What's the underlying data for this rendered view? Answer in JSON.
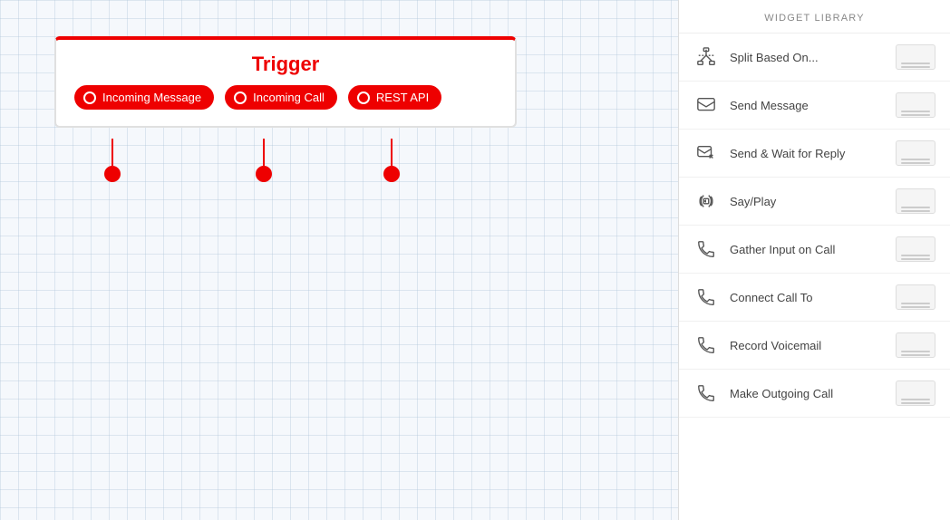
{
  "trigger": {
    "title": "Trigger",
    "buttons": [
      {
        "label": "Incoming Message"
      },
      {
        "label": "Incoming Call"
      },
      {
        "label": "REST API"
      }
    ]
  },
  "sidebar": {
    "header": "WIDGET LIBRARY",
    "widgets": [
      {
        "name": "split-based-on",
        "label": "Split Based On...",
        "icon": "split"
      },
      {
        "name": "send-message",
        "label": "Send Message",
        "icon": "message"
      },
      {
        "name": "send-wait-reply",
        "label": "Send & Wait for Reply",
        "icon": "message-reply"
      },
      {
        "name": "say-play",
        "label": "Say/Play",
        "icon": "phone"
      },
      {
        "name": "gather-input",
        "label": "Gather Input on Call",
        "icon": "phone"
      },
      {
        "name": "connect-call",
        "label": "Connect Call To",
        "icon": "phone"
      },
      {
        "name": "record-voicemail",
        "label": "Record Voicemail",
        "icon": "phone"
      },
      {
        "name": "make-outgoing-call",
        "label": "Make Outgoing Call",
        "icon": "phone"
      }
    ]
  }
}
